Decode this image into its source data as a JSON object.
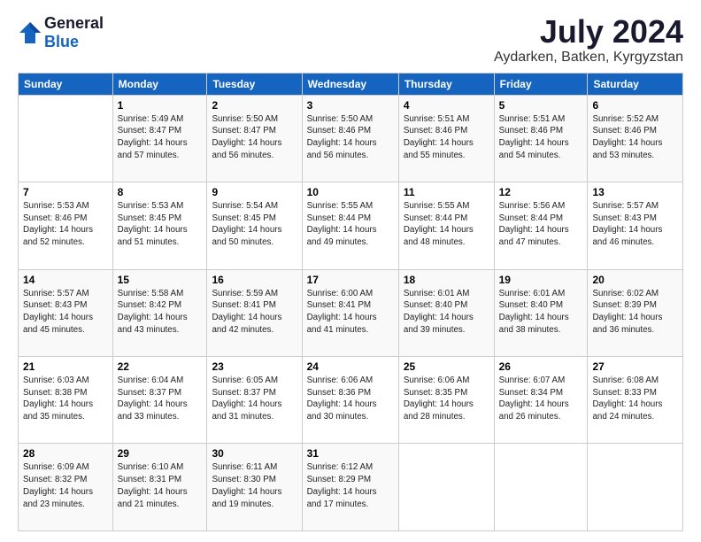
{
  "logo": {
    "general": "General",
    "blue": "Blue"
  },
  "title": "July 2024",
  "location": "Aydarken, Batken, Kyrgyzstan",
  "days_of_week": [
    "Sunday",
    "Monday",
    "Tuesday",
    "Wednesday",
    "Thursday",
    "Friday",
    "Saturday"
  ],
  "weeks": [
    [
      {
        "day": "",
        "info": ""
      },
      {
        "day": "1",
        "info": "Sunrise: 5:49 AM\nSunset: 8:47 PM\nDaylight: 14 hours\nand 57 minutes."
      },
      {
        "day": "2",
        "info": "Sunrise: 5:50 AM\nSunset: 8:47 PM\nDaylight: 14 hours\nand 56 minutes."
      },
      {
        "day": "3",
        "info": "Sunrise: 5:50 AM\nSunset: 8:46 PM\nDaylight: 14 hours\nand 56 minutes."
      },
      {
        "day": "4",
        "info": "Sunrise: 5:51 AM\nSunset: 8:46 PM\nDaylight: 14 hours\nand 55 minutes."
      },
      {
        "day": "5",
        "info": "Sunrise: 5:51 AM\nSunset: 8:46 PM\nDaylight: 14 hours\nand 54 minutes."
      },
      {
        "day": "6",
        "info": "Sunrise: 5:52 AM\nSunset: 8:46 PM\nDaylight: 14 hours\nand 53 minutes."
      }
    ],
    [
      {
        "day": "7",
        "info": "Sunrise: 5:53 AM\nSunset: 8:46 PM\nDaylight: 14 hours\nand 52 minutes."
      },
      {
        "day": "8",
        "info": "Sunrise: 5:53 AM\nSunset: 8:45 PM\nDaylight: 14 hours\nand 51 minutes."
      },
      {
        "day": "9",
        "info": "Sunrise: 5:54 AM\nSunset: 8:45 PM\nDaylight: 14 hours\nand 50 minutes."
      },
      {
        "day": "10",
        "info": "Sunrise: 5:55 AM\nSunset: 8:44 PM\nDaylight: 14 hours\nand 49 minutes."
      },
      {
        "day": "11",
        "info": "Sunrise: 5:55 AM\nSunset: 8:44 PM\nDaylight: 14 hours\nand 48 minutes."
      },
      {
        "day": "12",
        "info": "Sunrise: 5:56 AM\nSunset: 8:44 PM\nDaylight: 14 hours\nand 47 minutes."
      },
      {
        "day": "13",
        "info": "Sunrise: 5:57 AM\nSunset: 8:43 PM\nDaylight: 14 hours\nand 46 minutes."
      }
    ],
    [
      {
        "day": "14",
        "info": "Sunrise: 5:57 AM\nSunset: 8:43 PM\nDaylight: 14 hours\nand 45 minutes."
      },
      {
        "day": "15",
        "info": "Sunrise: 5:58 AM\nSunset: 8:42 PM\nDaylight: 14 hours\nand 43 minutes."
      },
      {
        "day": "16",
        "info": "Sunrise: 5:59 AM\nSunset: 8:41 PM\nDaylight: 14 hours\nand 42 minutes."
      },
      {
        "day": "17",
        "info": "Sunrise: 6:00 AM\nSunset: 8:41 PM\nDaylight: 14 hours\nand 41 minutes."
      },
      {
        "day": "18",
        "info": "Sunrise: 6:01 AM\nSunset: 8:40 PM\nDaylight: 14 hours\nand 39 minutes."
      },
      {
        "day": "19",
        "info": "Sunrise: 6:01 AM\nSunset: 8:40 PM\nDaylight: 14 hours\nand 38 minutes."
      },
      {
        "day": "20",
        "info": "Sunrise: 6:02 AM\nSunset: 8:39 PM\nDaylight: 14 hours\nand 36 minutes."
      }
    ],
    [
      {
        "day": "21",
        "info": "Sunrise: 6:03 AM\nSunset: 8:38 PM\nDaylight: 14 hours\nand 35 minutes."
      },
      {
        "day": "22",
        "info": "Sunrise: 6:04 AM\nSunset: 8:37 PM\nDaylight: 14 hours\nand 33 minutes."
      },
      {
        "day": "23",
        "info": "Sunrise: 6:05 AM\nSunset: 8:37 PM\nDaylight: 14 hours\nand 31 minutes."
      },
      {
        "day": "24",
        "info": "Sunrise: 6:06 AM\nSunset: 8:36 PM\nDaylight: 14 hours\nand 30 minutes."
      },
      {
        "day": "25",
        "info": "Sunrise: 6:06 AM\nSunset: 8:35 PM\nDaylight: 14 hours\nand 28 minutes."
      },
      {
        "day": "26",
        "info": "Sunrise: 6:07 AM\nSunset: 8:34 PM\nDaylight: 14 hours\nand 26 minutes."
      },
      {
        "day": "27",
        "info": "Sunrise: 6:08 AM\nSunset: 8:33 PM\nDaylight: 14 hours\nand 24 minutes."
      }
    ],
    [
      {
        "day": "28",
        "info": "Sunrise: 6:09 AM\nSunset: 8:32 PM\nDaylight: 14 hours\nand 23 minutes."
      },
      {
        "day": "29",
        "info": "Sunrise: 6:10 AM\nSunset: 8:31 PM\nDaylight: 14 hours\nand 21 minutes."
      },
      {
        "day": "30",
        "info": "Sunrise: 6:11 AM\nSunset: 8:30 PM\nDaylight: 14 hours\nand 19 minutes."
      },
      {
        "day": "31",
        "info": "Sunrise: 6:12 AM\nSunset: 8:29 PM\nDaylight: 14 hours\nand 17 minutes."
      },
      {
        "day": "",
        "info": ""
      },
      {
        "day": "",
        "info": ""
      },
      {
        "day": "",
        "info": ""
      }
    ]
  ]
}
